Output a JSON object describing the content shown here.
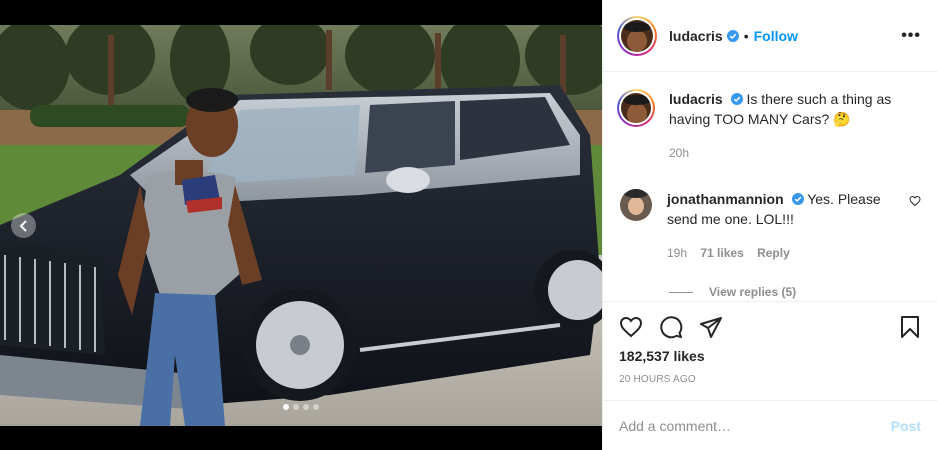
{
  "post": {
    "author": "ludacris",
    "follow_label": "Follow",
    "bullet": "•",
    "more_label": "•••"
  },
  "caption": {
    "username": "ludacris",
    "text": "Is there such a thing as having TOO MANY Cars? 🤔",
    "time": "20h"
  },
  "comment": {
    "username": "jonathanmannion",
    "text": "Yes. Please send me one. LOL!!!",
    "time": "19h",
    "likes": "71 likes",
    "reply_label": "Reply",
    "view_replies": "View replies (5)"
  },
  "engagement": {
    "likes": "182,537 likes",
    "time_ago": "20 hours ago"
  },
  "composer": {
    "placeholder": "Add a comment…",
    "post_label": "Post"
  },
  "carousel": {
    "slide_count": 4,
    "active_slide": 1
  },
  "colors": {
    "accent": "#0095f6",
    "post_disabled": "#b2dffc",
    "verified": "#3897f0"
  }
}
